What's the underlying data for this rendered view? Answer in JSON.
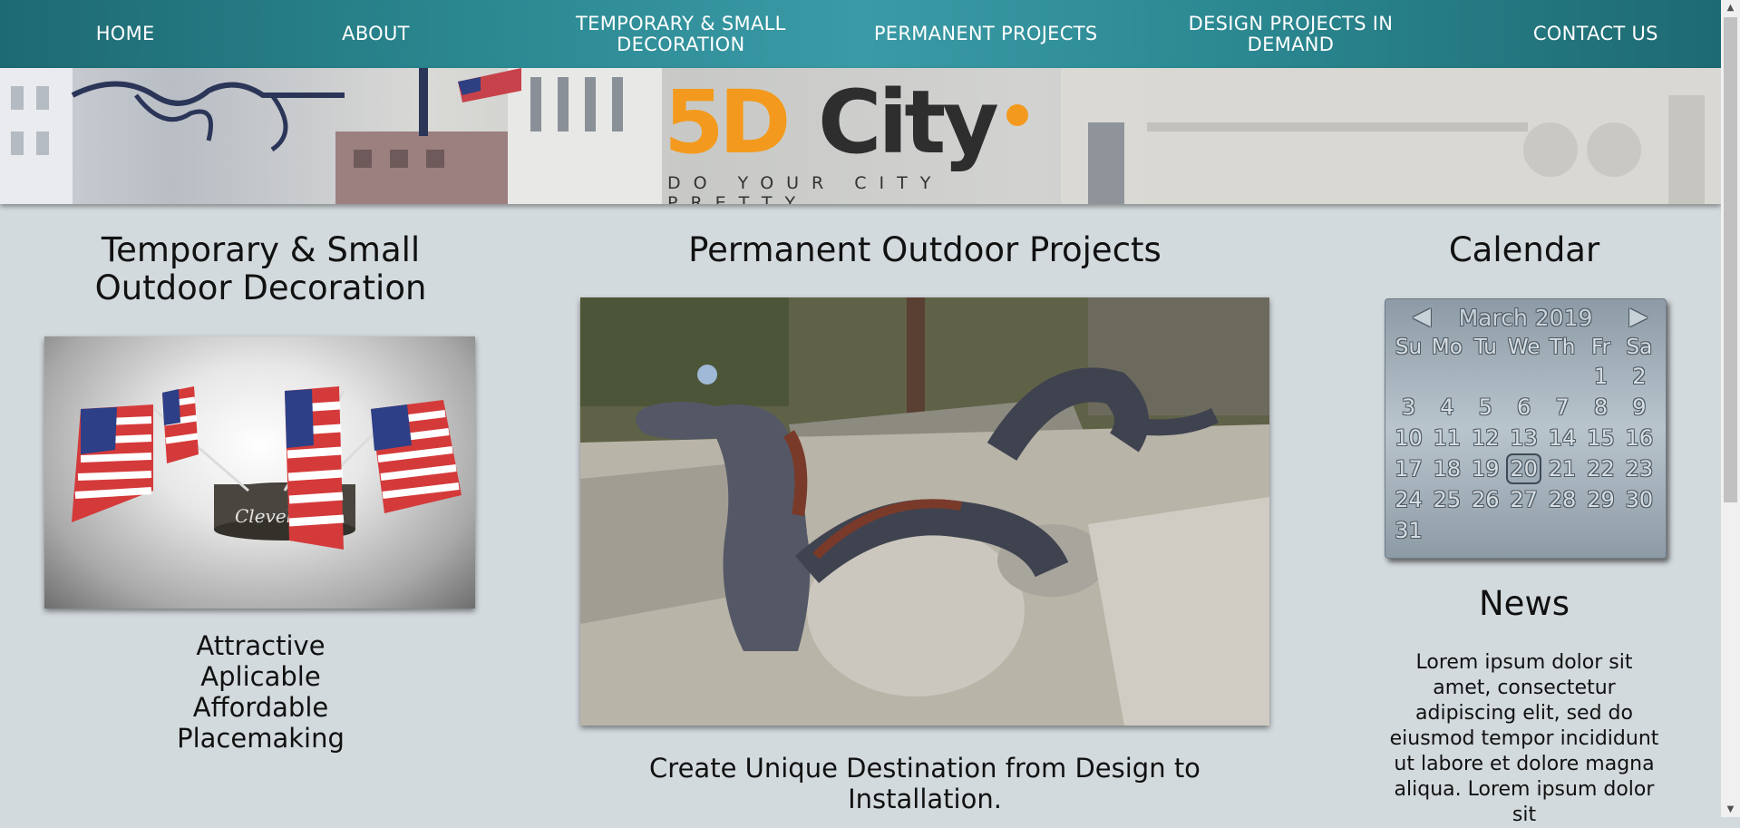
{
  "nav": {
    "items": [
      {
        "label": "HOME"
      },
      {
        "label": "ABOUT"
      },
      {
        "label": "TEMPORARY & SMALL DECORATION"
      },
      {
        "label": "PERMANENT PROJECTS"
      },
      {
        "label": "DESIGN PROJECTS IN DEMAND"
      },
      {
        "label": "CONTACT US"
      }
    ]
  },
  "banner": {
    "logo_5d": "5D",
    "logo_city": "City",
    "tagline": "DO YOUR CITY PRETTY"
  },
  "left": {
    "title": "Temporary & Small Outdoor Decoration",
    "lines": [
      "Attractive",
      "Aplicable",
      "Affordable",
      "Placemaking"
    ]
  },
  "middle": {
    "title": "Permanent Outdoor Projects",
    "caption": "Create Unique Destination from Design to Installation."
  },
  "calendar": {
    "title": "Calendar",
    "month": "March 2019",
    "prev_icon": "◀",
    "next_icon": "▶",
    "weekdays": [
      "Su",
      "Mo",
      "Tu",
      "We",
      "Th",
      "Fr",
      "Sa"
    ],
    "weeks": [
      [
        "",
        "",
        "",
        "",
        "",
        "1",
        "2"
      ],
      [
        "3",
        "4",
        "5",
        "6",
        "7",
        "8",
        "9"
      ],
      [
        "10",
        "11",
        "12",
        "13",
        "14",
        "15",
        "16"
      ],
      [
        "17",
        "18",
        "19",
        "20",
        "21",
        "22",
        "23"
      ],
      [
        "24",
        "25",
        "26",
        "27",
        "28",
        "29",
        "30"
      ],
      [
        "31",
        "",
        "",
        "",
        "",
        "",
        ""
      ]
    ],
    "today": "20"
  },
  "news": {
    "title": "News",
    "text": "Lorem ipsum dolor sit amet, consectetur adipiscing elit, sed do eiusmod tempor incididunt ut labore et dolore magna aliqua. Lorem ipsum dolor sit"
  },
  "colors": {
    "nav": "#2c8a93",
    "brand_orange": "#f39a1e",
    "background": "#d3dadd"
  }
}
